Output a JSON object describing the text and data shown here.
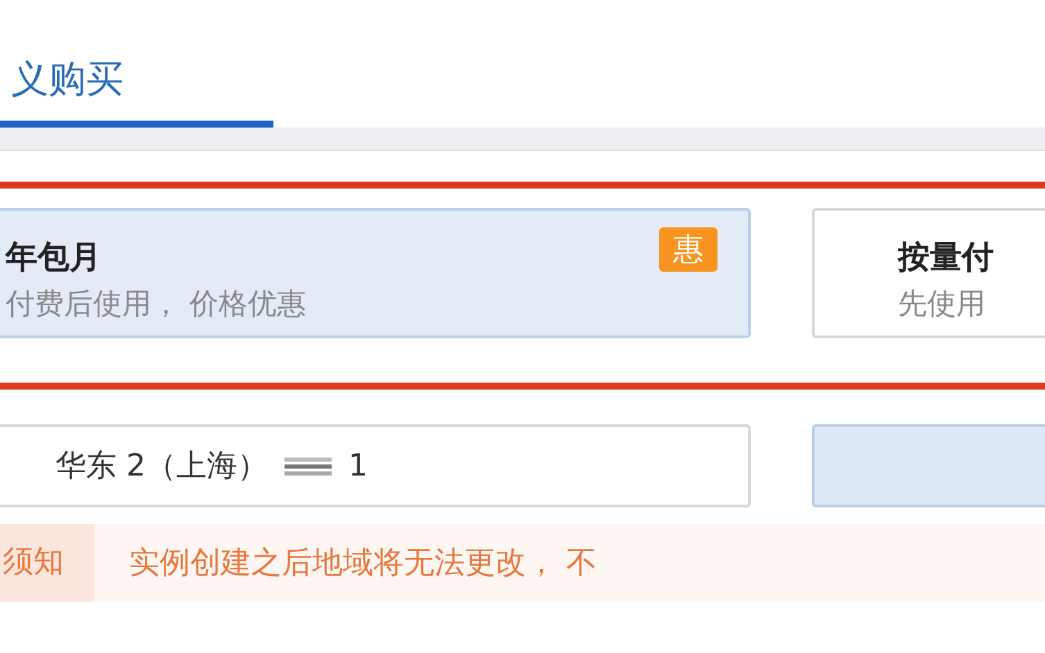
{
  "tabs": [
    {
      "label": "义购买",
      "selected": true
    }
  ],
  "billing_options": [
    {
      "title": "年包月",
      "description": "付费后使用， 价格优惠",
      "badge": "惠",
      "selected": true
    },
    {
      "title": "按量付",
      "description": "先使用",
      "selected": false
    }
  ],
  "regions": [
    {
      "label": "华东 2（上海）",
      "suffix": "1",
      "selected": false
    },
    {
      "selected": true
    }
  ],
  "notice": {
    "label": "须知",
    "text": "实例创建之后地域将无法更改， 不"
  }
}
